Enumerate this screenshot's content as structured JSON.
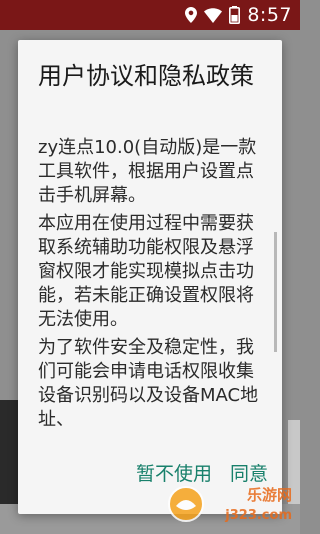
{
  "status_bar": {
    "time": "8:57",
    "icons": [
      "location-icon",
      "wifi-icon",
      "battery-icon"
    ],
    "color": "#7a1717"
  },
  "dialog": {
    "title": "用户协议和隐私政策",
    "paragraphs": [
      "zy连点10.0(自动版)是一款工具软件，根据用户设置点击手机屏幕。",
      "本应用在使用过程中需要获取系统辅助功能权限及悬浮窗权限才能实现模拟点击功能，若未能正确设置权限将无法使用。",
      "为了软件安全及稳定性，我们可能会申请电话权限收集设备识别码以及设备MAC地址、"
    ],
    "cancel_label": "暂不使用",
    "agree_label": "同意",
    "accent_color": "#18806b"
  },
  "watermark": {
    "text": "乐游网",
    "url": "j323.com"
  }
}
